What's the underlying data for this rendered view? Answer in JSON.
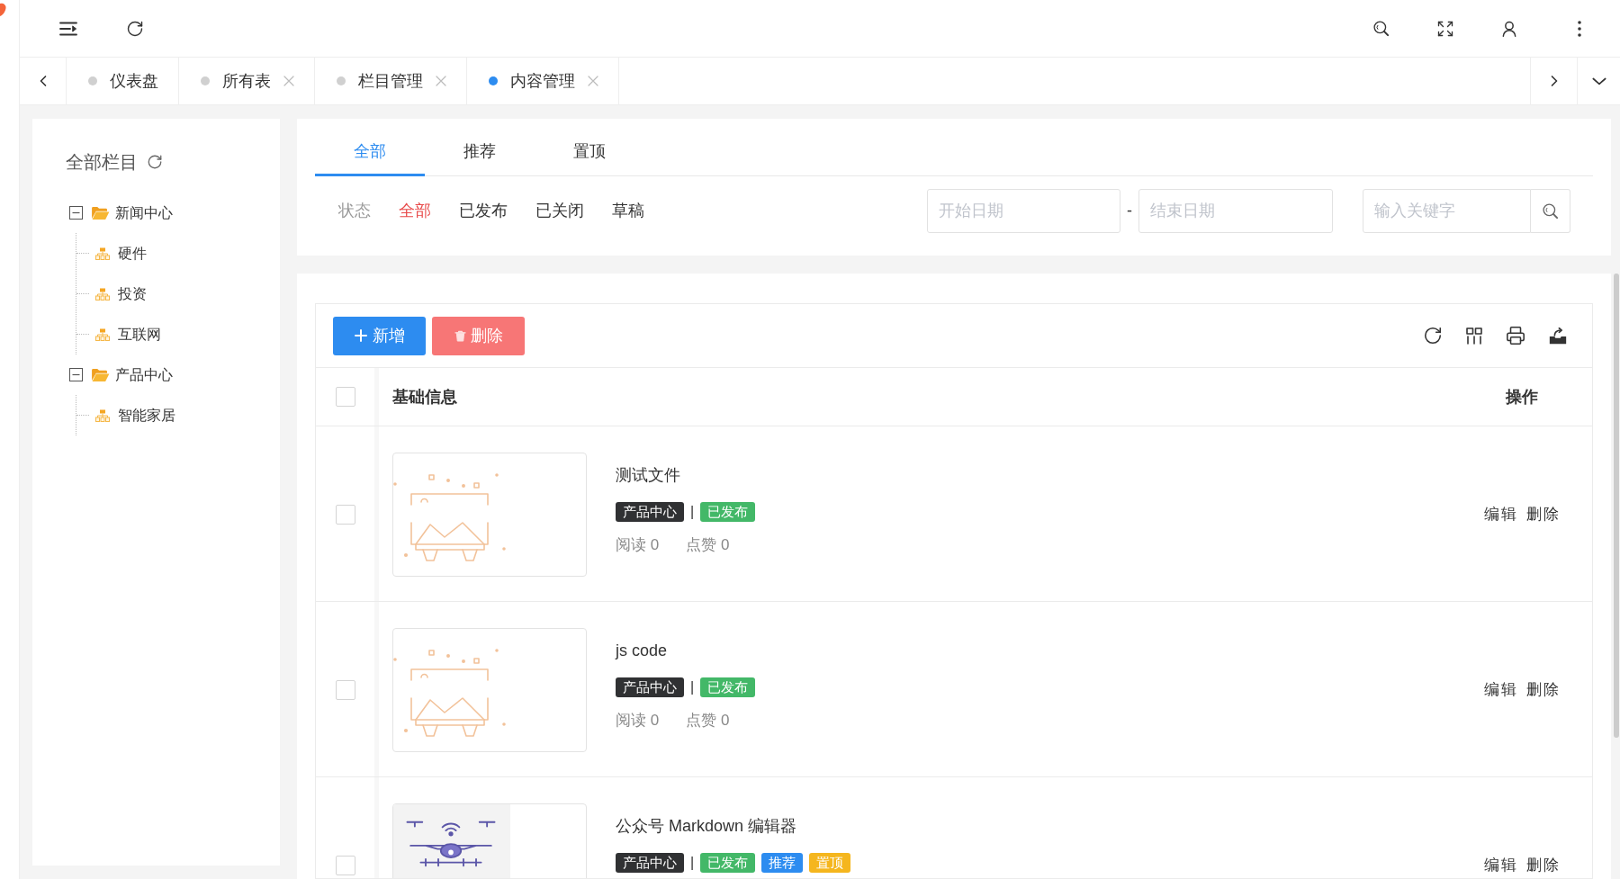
{
  "tab_bar": {
    "tabs": [
      {
        "label": "仪表盘",
        "selected": false,
        "closable": false
      },
      {
        "label": "所有表",
        "selected": false,
        "closable": true
      },
      {
        "label": "栏目管理",
        "selected": false,
        "closable": true
      },
      {
        "label": "内容管理",
        "selected": true,
        "closable": true
      }
    ]
  },
  "sidebar": {
    "title": "全部栏目",
    "tree": [
      {
        "label": "新闻中心",
        "expanded": true,
        "children": [
          {
            "label": "硬件"
          },
          {
            "label": "投资"
          },
          {
            "label": "互联网"
          }
        ]
      },
      {
        "label": "产品中心",
        "expanded": true,
        "children": [
          {
            "label": "智能家居"
          }
        ]
      }
    ]
  },
  "content_tabs": [
    {
      "label": "全部",
      "selected": true
    },
    {
      "label": "推荐",
      "selected": false
    },
    {
      "label": "置顶",
      "selected": false
    }
  ],
  "status_filter": {
    "label": "状态",
    "options": [
      {
        "label": "全部",
        "selected": true
      },
      {
        "label": "已发布",
        "selected": false
      },
      {
        "label": "已关闭",
        "selected": false
      },
      {
        "label": "草稿",
        "selected": false
      }
    ]
  },
  "date_range": {
    "start_placeholder": "开始日期",
    "separator": "-",
    "end_placeholder": "结束日期"
  },
  "keyword_search": {
    "placeholder": "输入关键字"
  },
  "toolbar": {
    "buttons": [
      {
        "label": "新增",
        "kind": "add"
      },
      {
        "label": "删除",
        "kind": "delete"
      }
    ]
  },
  "table": {
    "header_checked": false,
    "columns": [
      "基础信息",
      "操作"
    ],
    "rows": [
      {
        "checked": false,
        "image": {
          "kind": "placeholder"
        },
        "title": "测试文件",
        "category": "产品中心",
        "separator": "|",
        "tags": [
          {
            "label": "已发布",
            "color": "#43b868"
          }
        ],
        "stats": [
          "阅读 0",
          "点赞 0"
        ],
        "actions": [
          "编辑",
          "删除"
        ]
      },
      {
        "checked": false,
        "image": {
          "kind": "placeholder"
        },
        "title": "js code",
        "category": "产品中心",
        "separator": "|",
        "tags": [
          {
            "label": "已发布",
            "color": "#43b868"
          }
        ],
        "stats": [
          "阅读 0",
          "点赞 0"
        ],
        "actions": [
          "编辑",
          "删除"
        ]
      },
      {
        "checked": false,
        "image": {
          "kind": "illustration"
        },
        "title": "公众号 Markdown 编辑器",
        "category": "产品中心",
        "separator": "|",
        "tags": [
          {
            "label": "已发布",
            "color": "#43b868"
          },
          {
            "label": "推荐",
            "color": "#2d8cf0"
          },
          {
            "label": "置顶",
            "color": "#f5b61e"
          }
        ],
        "actions": [
          "编辑",
          "删除"
        ]
      }
    ]
  }
}
